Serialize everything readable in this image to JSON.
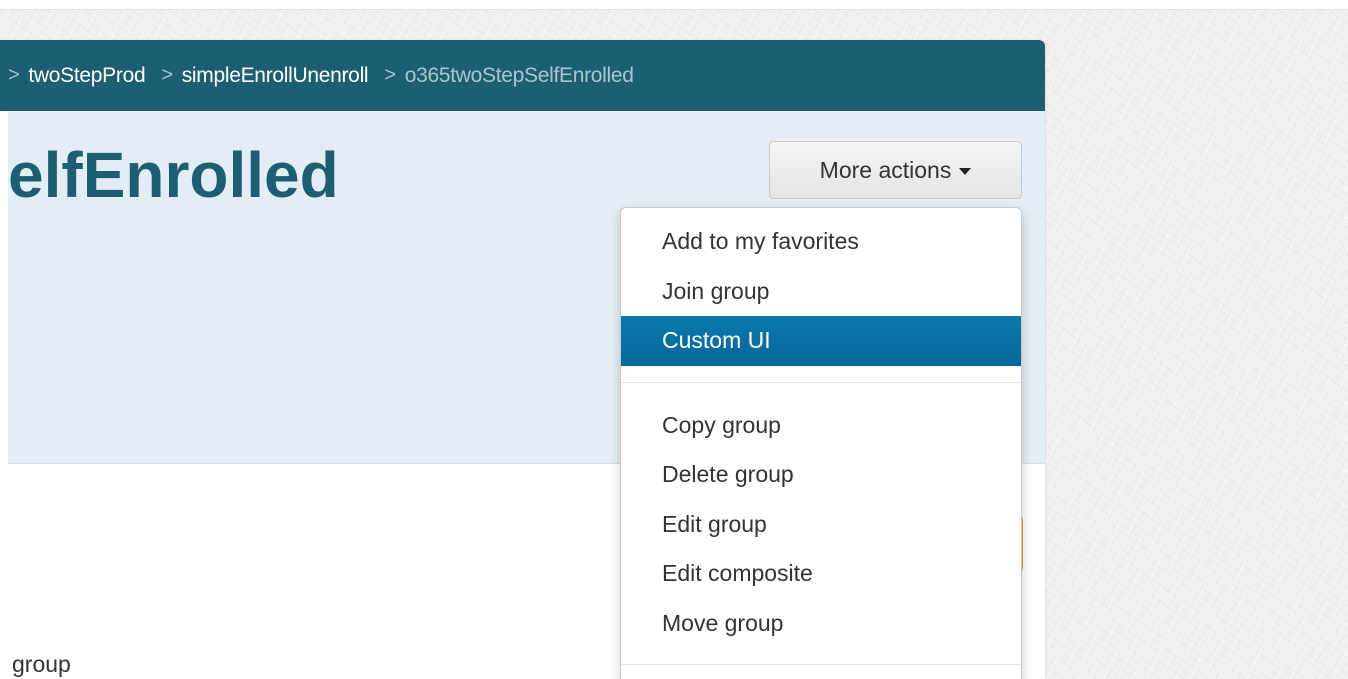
{
  "breadcrumb": [
    {
      "label": "twoStepProd",
      "current": false
    },
    {
      "label": "simpleEnrollUnenroll",
      "current": false
    },
    {
      "label": "o365twoStepSelfEnrolled",
      "current": true
    }
  ],
  "breadcrumb_separator": ">",
  "page_title": "elfEnrolled",
  "more_actions": {
    "label": "More actions"
  },
  "menu": {
    "group1": [
      {
        "label": "Add to my favorites"
      },
      {
        "label": "Join group"
      },
      {
        "label": "Custom UI",
        "active": true
      }
    ],
    "group2": [
      {
        "label": "Copy group"
      },
      {
        "label": "Delete group"
      },
      {
        "label": "Edit group"
      },
      {
        "label": "Edit composite"
      },
      {
        "label": "Move group"
      }
    ]
  },
  "body_text": "group",
  "colors": {
    "header_bar": "#1d5f72",
    "header_band": "#e4ecf5",
    "menu_active": "#0a78ab",
    "accent_orange": "#e09a3c"
  }
}
